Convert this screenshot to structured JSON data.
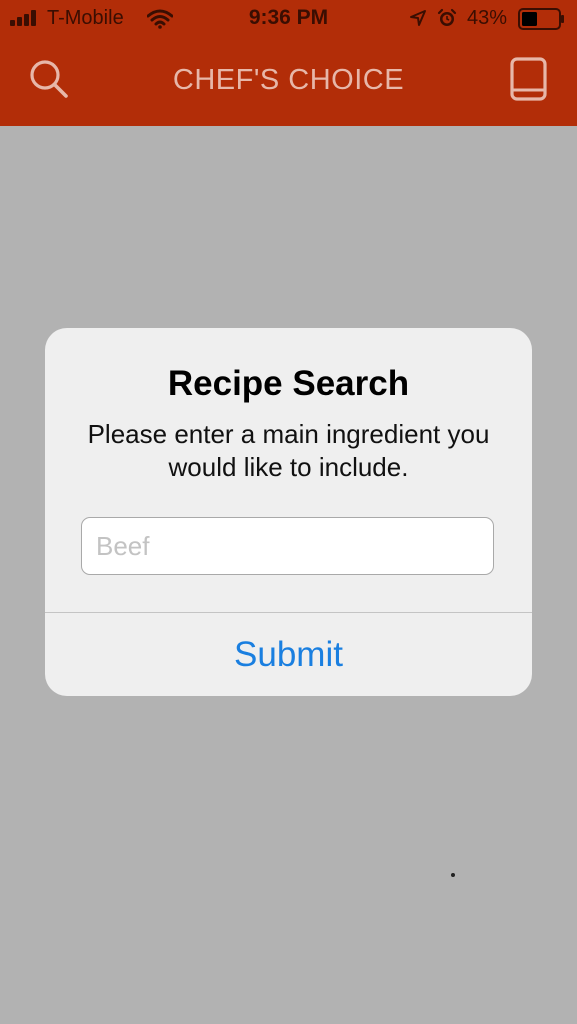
{
  "status_bar": {
    "carrier": "T-Mobile",
    "time": "9:36 PM",
    "battery_percent": "43%",
    "battery_level": 0.43,
    "icons": [
      "signal-icon",
      "wifi-icon",
      "location-icon",
      "alarm-icon",
      "battery-icon"
    ]
  },
  "nav": {
    "title": "CHEF'S CHOICE",
    "left_icon": "search-icon",
    "right_icon": "book-icon",
    "background": "#b22d08"
  },
  "dialog": {
    "title": "Recipe Search",
    "message": "Please enter a main ingredient you would like to include.",
    "input": {
      "value": "",
      "placeholder": "Beef"
    },
    "submit_label": "Submit",
    "accent": "#1a7fe0"
  }
}
